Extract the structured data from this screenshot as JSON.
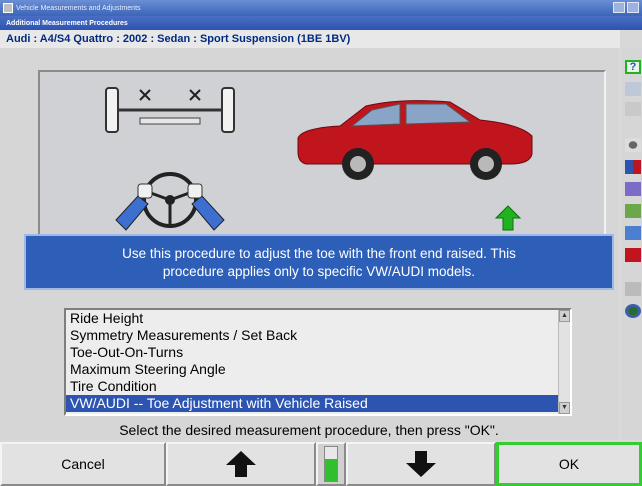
{
  "window": {
    "title": "Vehicle Measurements and Adjustments",
    "subtitle": "Additional Measurement Procedures"
  },
  "vehicle": {
    "description": "Audi : A4/S4 Quattro : 2002 : Sedan : Sport Suspension (1BE 1BV)"
  },
  "illustration": {
    "car_color": "#c0151c",
    "arrow_color": "#1fb31f"
  },
  "instruction": {
    "line1": "Use this procedure to adjust the toe with the front end raised.  This",
    "line2": "procedure applies only to specific VW/AUDI models."
  },
  "procedures": {
    "items": [
      {
        "label": "Ride Height"
      },
      {
        "label": "Symmetry Measurements / Set Back"
      },
      {
        "label": "Toe-Out-On-Turns"
      },
      {
        "label": "Maximum Steering Angle"
      },
      {
        "label": "Tire Condition"
      },
      {
        "label": "VW/AUDI -- Toe Adjustment with Vehicle Raised"
      }
    ],
    "selected_index": 5
  },
  "prompt": "Select the desired measurement procedure, then press \"OK\".",
  "buttons": {
    "cancel": "Cancel",
    "up": "up-arrow-icon",
    "down": "down-arrow-icon",
    "ok": "OK"
  },
  "sidebar": {
    "help_label": "?"
  }
}
